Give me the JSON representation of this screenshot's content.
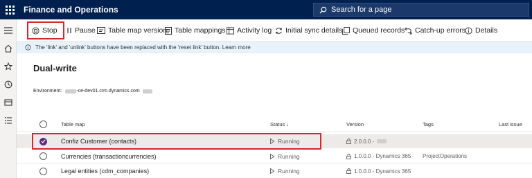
{
  "app": {
    "title": "Finance and Operations"
  },
  "search": {
    "placeholder": "Search for a page"
  },
  "toolbar": {
    "stop": "Stop",
    "pause": "Pause",
    "table_map_version": "Table map version",
    "table_mappings": "Table mappings",
    "activity_log": "Activity log",
    "initial_sync": "Initial sync details",
    "queued_records": "Queued records",
    "catchup_errors": "Catch-up errors",
    "details": "Details"
  },
  "info": {
    "message": "The 'link' and 'unlink' buttons have been replaced with the 'reset link' button. Learn more"
  },
  "page": {
    "title": "Dual-write",
    "environment_label": "Environment:",
    "environment_value": "-ce-dev01.crm.dynamics.com"
  },
  "table": {
    "headers": {
      "table_map": "Table map",
      "status": "Status ↓",
      "version": "Version",
      "tags": "Tags",
      "last_issue": "Last issue"
    },
    "rows": [
      {
        "name": "Confiz Customer (contacts)",
        "status": "Running",
        "version": "2.0.0.0 -",
        "tags": "",
        "selected": true
      },
      {
        "name": "Currencies (transactioncurrencies)",
        "status": "Running",
        "version": "1.0.0.0 - Dynamics 365",
        "tags": "ProjectOperations",
        "selected": false
      },
      {
        "name": "Legal entities (cdm_companies)",
        "status": "Running",
        "version": "1.0.0.0 - Dynamics 365",
        "tags": "",
        "selected": false
      }
    ]
  },
  "colors": {
    "topbar": "#002050",
    "highlight": "#d8262d",
    "selected_radio": "#5b2a86",
    "info_bg": "#e8f2fb"
  }
}
